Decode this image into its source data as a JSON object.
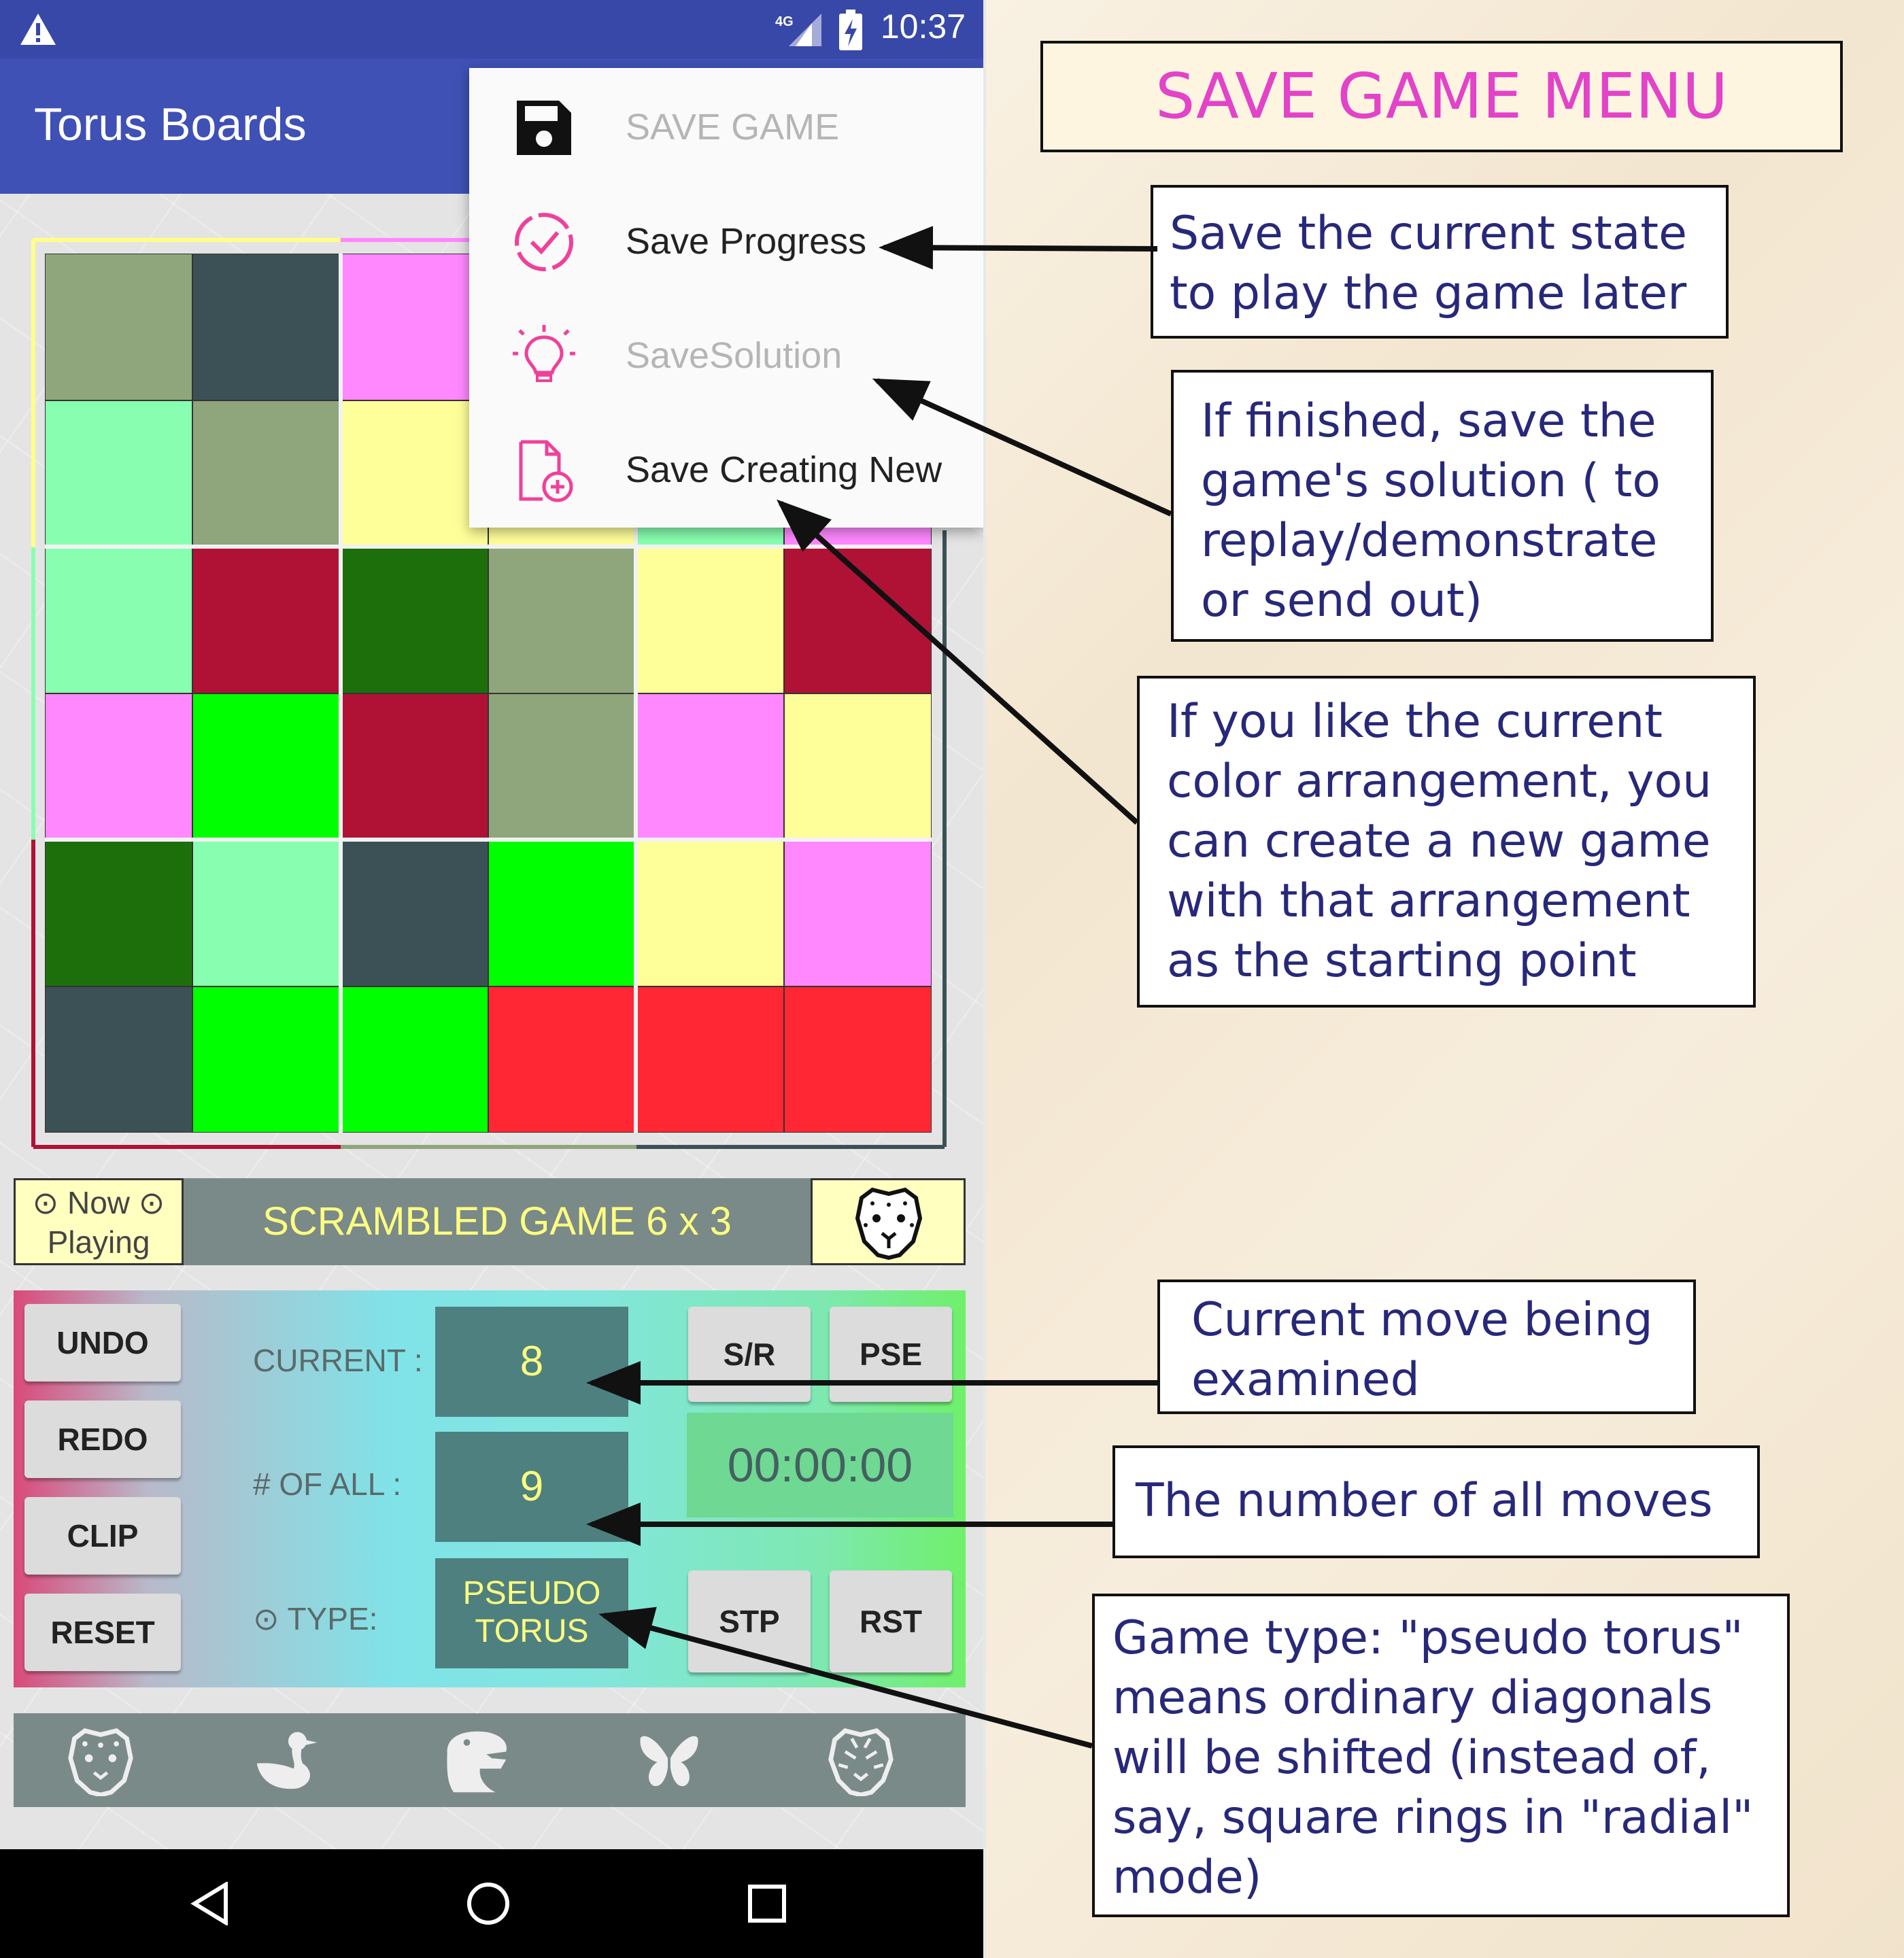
{
  "status_bar": {
    "time": "10:37",
    "network_label": "4G"
  },
  "app_bar": {
    "title": "Torus Boards"
  },
  "menu": {
    "items": [
      {
        "label": "SAVE GAME",
        "icon": "save-icon",
        "enabled": false
      },
      {
        "label": "Save Progress",
        "icon": "check-circle-icon",
        "enabled": true
      },
      {
        "label": "SaveSolution",
        "icon": "lightbulb-icon",
        "enabled": false
      },
      {
        "label": "Save Creating New",
        "icon": "new-file-icon",
        "enabled": true
      }
    ]
  },
  "board": {
    "rows": 6,
    "cols": 6,
    "cells": [
      [
        "#8fa67c",
        "#3b5155",
        "#ff88ff",
        "#ff88ff",
        "#ffff99",
        "#ff88ff"
      ],
      [
        "#88ffb0",
        "#8fa67c",
        "#ffff99",
        "#ffff99",
        "#88ffb0",
        "#ff88ff"
      ],
      [
        "#88ffb0",
        "#b01236",
        "#1d6f0c",
        "#8fa67c",
        "#ffff99",
        "#b01236"
      ],
      [
        "#ff88ff",
        "#00ff00",
        "#b01236",
        "#8fa67c",
        "#ff88ff",
        "#ffff99"
      ],
      [
        "#1d6f0c",
        "#88ffb0",
        "#3b5155",
        "#00ff00",
        "#ffff99",
        "#ff88ff"
      ],
      [
        "#3b5155",
        "#00ff00",
        "#00ff00",
        "#ff2733",
        "#ff2733",
        "#ff2733"
      ]
    ]
  },
  "now_playing": {
    "line1": "⊙ Now ⊙",
    "line2": "Playing"
  },
  "game_title": "SCRAMBLED GAME 6 x 3",
  "controls": {
    "undo": "UNDO",
    "redo": "REDO",
    "clip": "CLIP",
    "reset": "RESET",
    "current_label": "CURRENT :",
    "current_value": "8",
    "all_label": "# OF ALL :",
    "all_value": "9",
    "type_label": "⊙ TYPE:",
    "type_value_1": "PSEUDO",
    "type_value_2": "TORUS",
    "sr": "S/R",
    "pse": "PSE",
    "timer": "00:00:00",
    "stp": "STP",
    "rst": "RST"
  },
  "bottom_icons": [
    "cheetah-icon",
    "duck-icon",
    "dinosaur-icon",
    "butterfly-icon",
    "tiger-icon"
  ],
  "nav_icons": [
    "back-icon",
    "home-icon",
    "recents-icon"
  ],
  "annotations": {
    "title": "SAVE GAME MENU",
    "save_progress": [
      "Save the current state",
      "to play the game later"
    ],
    "save_solution": [
      "If finished, save the",
      "game's solution ( to",
      "replay/demonstrate",
      "or send out)"
    ],
    "save_new": [
      "If you like the current",
      "color arrangement, you",
      "can create a new game",
      "with that arrangement",
      "as the starting point"
    ],
    "current_move": [
      "Current move being",
      "examined"
    ],
    "all_moves": [
      "The number of all moves"
    ],
    "game_type": [
      "Game type: \"pseudo torus\"",
      "means ordinary diagonals",
      "will be shifted (instead of,",
      "say, square rings in \"radial\"",
      "mode)"
    ]
  },
  "colors": {
    "app_bar": "#3f51b5",
    "status_bar": "#3848a8",
    "title_pink": "#e243c8",
    "note_text": "#28287a",
    "value_box": "#4e8080",
    "value_text": "#ffff80"
  }
}
